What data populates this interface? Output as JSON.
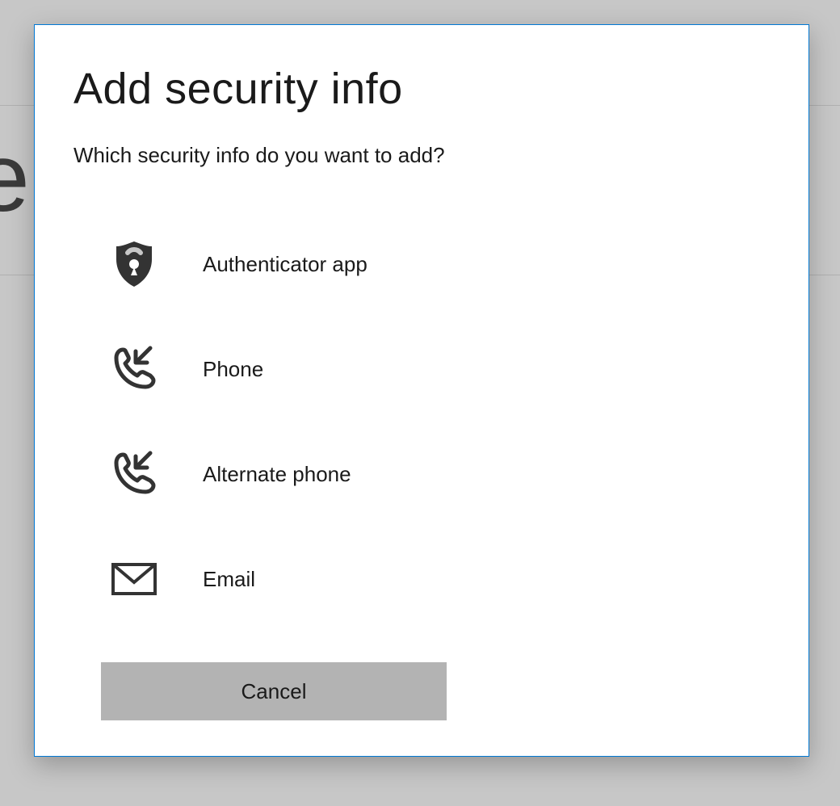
{
  "dialog": {
    "title": "Add security info",
    "subtitle": "Which security info do you want to add?",
    "options": [
      {
        "label": "Authenticator app"
      },
      {
        "label": "Phone"
      },
      {
        "label": "Alternate phone"
      },
      {
        "label": "Email"
      }
    ],
    "cancel_label": "Cancel"
  }
}
